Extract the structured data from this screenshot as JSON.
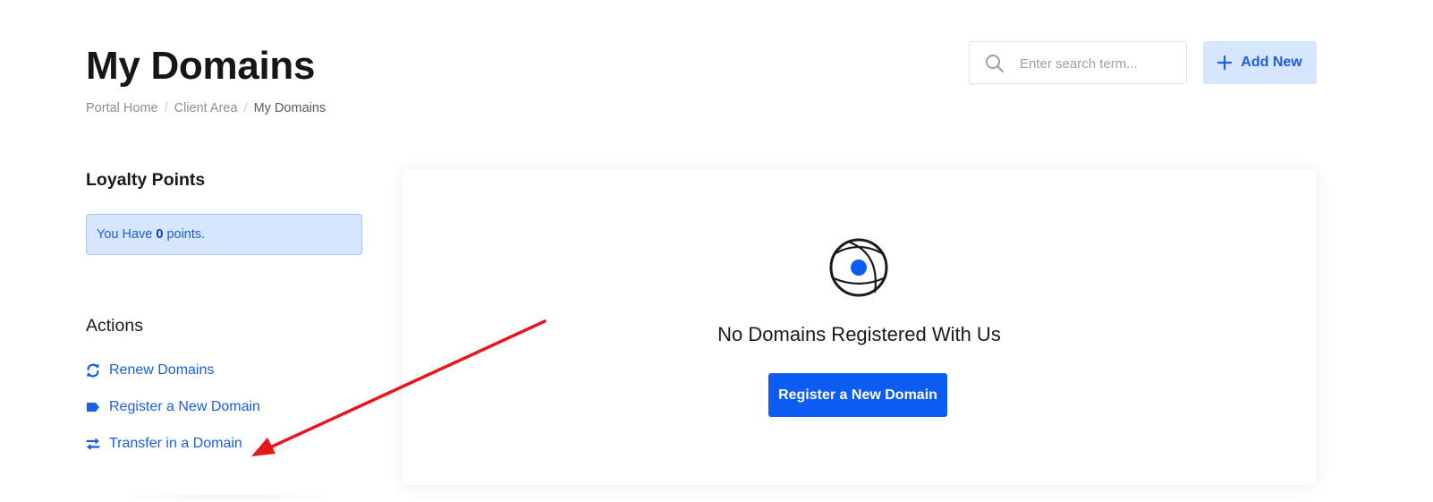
{
  "header": {
    "title": "My Domains",
    "breadcrumb": [
      {
        "label": "Portal Home"
      },
      {
        "label": "Client Area"
      },
      {
        "label": "My Domains"
      }
    ],
    "breadcrumb_separator": "/",
    "search_placeholder": "Enter search term...",
    "add_new_label": "Add New"
  },
  "sidebar": {
    "loyalty": {
      "heading": "Loyalty Points",
      "text_before": "You Have",
      "points": "0",
      "text_after": "points."
    },
    "actions": {
      "heading": "Actions",
      "items": [
        {
          "label": "Renew Domains",
          "icon": "sync-icon"
        },
        {
          "label": "Register a New Domain",
          "icon": "tag-icon"
        },
        {
          "label": "Transfer in a Domain",
          "icon": "exchange-icon"
        }
      ]
    }
  },
  "main": {
    "empty_state": {
      "icon": "globe-icon",
      "title": "No Domains Registered With Us",
      "button_label": "Register a New Domain"
    }
  },
  "colors": {
    "accent": "#0d5df5",
    "link": "#1b5ee0",
    "light_accent": "#d7e5fe",
    "annotation": "#e8151b"
  }
}
